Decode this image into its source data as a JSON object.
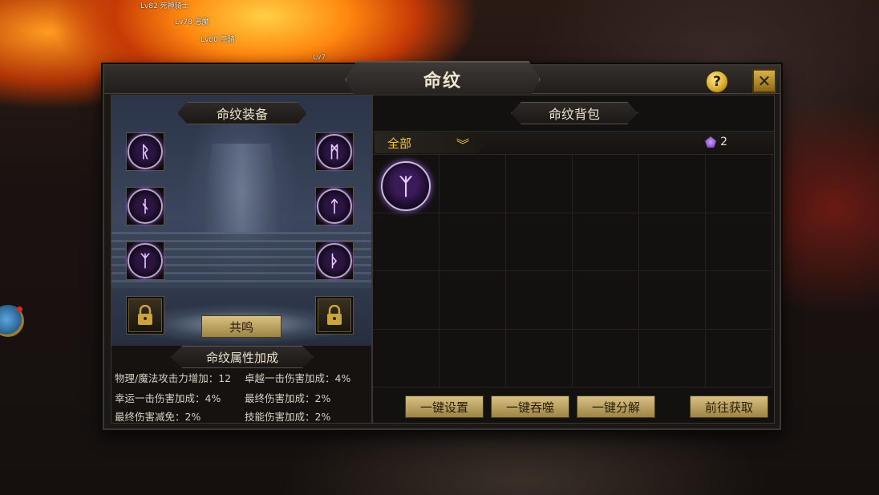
{
  "window": {
    "title": "命纹",
    "help_label": "?",
    "close_label": "✕"
  },
  "hud": {
    "players": [
      "Lv82 死神骑士",
      "Lv78 恶魔",
      "Lv80 圣骑",
      "Lv7"
    ]
  },
  "equip_panel": {
    "header": "命纹装备",
    "slots": [
      {
        "glyph": "ᚱ",
        "locked": false
      },
      {
        "glyph": "ᛗ",
        "locked": false
      },
      {
        "glyph": "ᚾ",
        "locked": false
      },
      {
        "glyph": "ᛏ",
        "locked": false
      },
      {
        "glyph": "ᛉ",
        "locked": false
      },
      {
        "glyph": "ᚦ",
        "locked": false
      },
      {
        "glyph": "",
        "locked": true
      },
      {
        "glyph": "",
        "locked": true
      }
    ],
    "resonate_label": "共鸣",
    "attr_header": "命纹属性加成",
    "attrs": [
      "物理/魔法攻击力增加：12",
      "卓越一击伤害加成：4%",
      "幸运一击伤害加成：4%",
      "最终伤害加成：2%",
      "最终伤害减免：2%",
      "技能伤害加成：2%"
    ]
  },
  "bag_panel": {
    "header": "命纹背包",
    "filter_selected": "全部",
    "count": "2",
    "items": [
      {
        "glyph": "ᛉ"
      }
    ],
    "buttons": [
      "一键设置",
      "一键吞噬",
      "一键分解",
      "前往获取"
    ]
  },
  "colors": {
    "accent_gold": "#f0c43a",
    "rune_purple": "#9a5ae0",
    "button_gold": "#d8c184"
  }
}
